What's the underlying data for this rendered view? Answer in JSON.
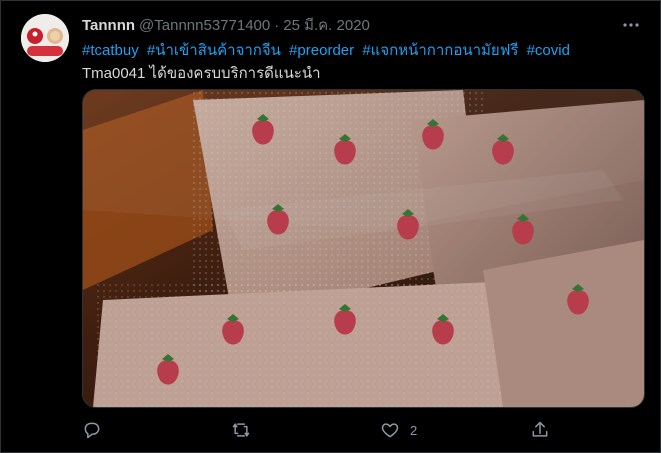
{
  "tweet": {
    "display_name": "Tannnn",
    "handle": "@Tannnn53771400",
    "separator": "·",
    "date": "25 มี.ค. 2020",
    "hashtags": [
      "#tcatbuy",
      "#นำเข้าสินค้าจากจีน",
      "#preorder",
      "#แจกหน้ากากอนามัยฟรี",
      "#covid"
    ],
    "text": "Tma0041 ได้ของครบบริการดีแนะนำ",
    "likes": "2"
  },
  "icons": {
    "more": "more-dots-icon",
    "reply": "reply-icon",
    "retweet": "retweet-icon",
    "like": "heart-icon",
    "share": "share-icon"
  },
  "colors": {
    "background": "#000000",
    "text": "#d9d9d9",
    "muted": "#6e767d",
    "link": "#1da1f2",
    "border": "#2f3336"
  }
}
